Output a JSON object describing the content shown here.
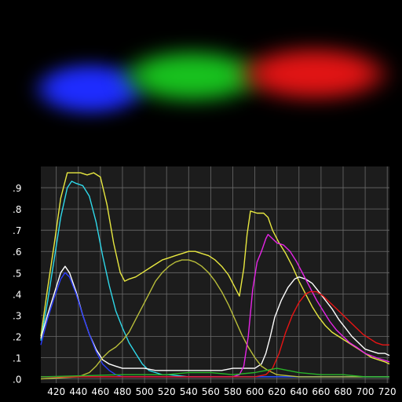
{
  "spectrum_strip": {
    "bands": [
      {
        "name": "blue-band",
        "color": "#1e2cff"
      },
      {
        "name": "green-band",
        "color": "#18c21e"
      },
      {
        "name": "red-band",
        "color": "#e11414"
      }
    ]
  },
  "chart_data": {
    "type": "line",
    "title": "",
    "xlabel": "",
    "ylabel": "",
    "xlim": [
      406,
      722
    ],
    "ylim": [
      -0.02,
      1.0
    ],
    "grid": true,
    "background": "#1c1c1c",
    "gridColor": "#6a6a6a",
    "x_ticks": [
      {
        "value": 420,
        "label": "420"
      },
      {
        "value": 440,
        "label": "440"
      },
      {
        "value": 460,
        "label": "460"
      },
      {
        "value": 480,
        "label": "480"
      },
      {
        "value": 500,
        "label": "500"
      },
      {
        "value": 520,
        "label": "520"
      },
      {
        "value": 540,
        "label": "540"
      },
      {
        "value": 560,
        "label": "560"
      },
      {
        "value": 580,
        "label": "580"
      },
      {
        "value": 600,
        "label": "600"
      },
      {
        "value": 620,
        "label": "620"
      },
      {
        "value": 640,
        "label": "640"
      },
      {
        "value": 660,
        "label": "660"
      },
      {
        "value": 680,
        "label": "680"
      },
      {
        "value": 700,
        "label": "700"
      },
      {
        "value": 720,
        "label": "720"
      }
    ],
    "y_ticks": [
      {
        "value": 0.0,
        "label": ".0"
      },
      {
        "value": 0.1,
        "label": ".1"
      },
      {
        "value": 0.2,
        "label": ".2"
      },
      {
        "value": 0.3,
        "label": ".3"
      },
      {
        "value": 0.4,
        "label": ".4"
      },
      {
        "value": 0.5,
        "label": ".5"
      },
      {
        "value": 0.6,
        "label": ".6"
      },
      {
        "value": 0.7,
        "label": ".7"
      },
      {
        "value": 0.8,
        "label": ".8"
      },
      {
        "value": 0.9,
        "label": ".9"
      }
    ],
    "series": [
      {
        "id": "yellow",
        "color": "#e8e840",
        "points": [
          [
            406,
            0.2
          ],
          [
            412,
            0.42
          ],
          [
            418,
            0.63
          ],
          [
            424,
            0.85
          ],
          [
            430,
            0.97
          ],
          [
            436,
            0.97
          ],
          [
            442,
            0.97
          ],
          [
            448,
            0.96
          ],
          [
            454,
            0.97
          ],
          [
            460,
            0.95
          ],
          [
            466,
            0.82
          ],
          [
            472,
            0.64
          ],
          [
            478,
            0.5
          ],
          [
            482,
            0.46
          ],
          [
            486,
            0.47
          ],
          [
            492,
            0.48
          ],
          [
            498,
            0.5
          ],
          [
            504,
            0.52
          ],
          [
            510,
            0.54
          ],
          [
            516,
            0.56
          ],
          [
            522,
            0.57
          ],
          [
            528,
            0.58
          ],
          [
            534,
            0.59
          ],
          [
            540,
            0.6
          ],
          [
            546,
            0.6
          ],
          [
            552,
            0.59
          ],
          [
            558,
            0.58
          ],
          [
            564,
            0.56
          ],
          [
            570,
            0.53
          ],
          [
            576,
            0.49
          ],
          [
            582,
            0.43
          ],
          [
            586,
            0.39
          ],
          [
            590,
            0.52
          ],
          [
            593,
            0.68
          ],
          [
            596,
            0.79
          ],
          [
            602,
            0.78
          ],
          [
            608,
            0.78
          ],
          [
            612,
            0.76
          ],
          [
            616,
            0.7
          ],
          [
            622,
            0.64
          ],
          [
            628,
            0.59
          ],
          [
            634,
            0.53
          ],
          [
            640,
            0.46
          ],
          [
            646,
            0.4
          ],
          [
            652,
            0.34
          ],
          [
            658,
            0.29
          ],
          [
            664,
            0.25
          ],
          [
            670,
            0.22
          ],
          [
            676,
            0.2
          ],
          [
            682,
            0.18
          ],
          [
            688,
            0.16
          ],
          [
            694,
            0.14
          ],
          [
            700,
            0.12
          ],
          [
            706,
            0.1
          ],
          [
            712,
            0.09
          ],
          [
            718,
            0.08
          ],
          [
            722,
            0.07
          ]
        ]
      },
      {
        "id": "cyan",
        "color": "#2fd9ea",
        "points": [
          [
            406,
            0.18
          ],
          [
            412,
            0.36
          ],
          [
            418,
            0.56
          ],
          [
            424,
            0.76
          ],
          [
            430,
            0.9
          ],
          [
            434,
            0.93
          ],
          [
            438,
            0.92
          ],
          [
            444,
            0.91
          ],
          [
            450,
            0.86
          ],
          [
            456,
            0.74
          ],
          [
            462,
            0.58
          ],
          [
            468,
            0.44
          ],
          [
            474,
            0.32
          ],
          [
            480,
            0.24
          ],
          [
            486,
            0.17
          ],
          [
            492,
            0.12
          ],
          [
            498,
            0.07
          ],
          [
            504,
            0.04
          ],
          [
            510,
            0.03
          ],
          [
            516,
            0.02
          ],
          [
            522,
            0.02
          ],
          [
            540,
            0.01
          ],
          [
            600,
            0.01
          ],
          [
            660,
            0.01
          ],
          [
            722,
            0.01
          ]
        ]
      },
      {
        "id": "white-left",
        "color": "#ffffff",
        "points": [
          [
            406,
            0.19
          ],
          [
            412,
            0.3
          ],
          [
            418,
            0.4
          ],
          [
            424,
            0.5
          ],
          [
            428,
            0.53
          ],
          [
            432,
            0.5
          ],
          [
            438,
            0.41
          ],
          [
            444,
            0.3
          ],
          [
            450,
            0.21
          ],
          [
            456,
            0.14
          ],
          [
            462,
            0.09
          ],
          [
            468,
            0.07
          ],
          [
            474,
            0.06
          ],
          [
            480,
            0.05
          ],
          [
            490,
            0.05
          ],
          [
            500,
            0.05
          ],
          [
            510,
            0.04
          ],
          [
            520,
            0.04
          ],
          [
            530,
            0.04
          ],
          [
            540,
            0.04
          ],
          [
            550,
            0.04
          ],
          [
            560,
            0.04
          ],
          [
            570,
            0.04
          ],
          [
            580,
            0.05
          ],
          [
            590,
            0.05
          ],
          [
            600,
            0.05
          ],
          [
            606,
            0.07
          ],
          [
            610,
            0.12
          ],
          [
            614,
            0.2
          ],
          [
            618,
            0.29
          ],
          [
            624,
            0.37
          ],
          [
            630,
            0.43
          ],
          [
            636,
            0.47
          ],
          [
            640,
            0.48
          ],
          [
            646,
            0.47
          ],
          [
            652,
            0.45
          ],
          [
            658,
            0.41
          ],
          [
            664,
            0.37
          ],
          [
            670,
            0.33
          ],
          [
            676,
            0.28
          ],
          [
            682,
            0.24
          ],
          [
            688,
            0.2
          ],
          [
            694,
            0.17
          ],
          [
            700,
            0.14
          ],
          [
            706,
            0.13
          ],
          [
            712,
            0.12
          ],
          [
            718,
            0.12
          ],
          [
            722,
            0.11
          ]
        ]
      },
      {
        "id": "blue",
        "color": "#2b3cff",
        "points": [
          [
            406,
            0.16
          ],
          [
            412,
            0.28
          ],
          [
            418,
            0.38
          ],
          [
            424,
            0.47
          ],
          [
            428,
            0.5
          ],
          [
            432,
            0.48
          ],
          [
            438,
            0.4
          ],
          [
            444,
            0.3
          ],
          [
            450,
            0.21
          ],
          [
            456,
            0.13
          ],
          [
            462,
            0.07
          ],
          [
            468,
            0.04
          ],
          [
            474,
            0.02
          ],
          [
            480,
            0.01
          ],
          [
            500,
            0.01
          ],
          [
            600,
            0.01
          ],
          [
            722,
            0.01
          ]
        ]
      },
      {
        "id": "olive",
        "color": "#b8bd3a",
        "points": [
          [
            406,
            0.0
          ],
          [
            440,
            0.01
          ],
          [
            450,
            0.03
          ],
          [
            456,
            0.06
          ],
          [
            462,
            0.1
          ],
          [
            468,
            0.13
          ],
          [
            474,
            0.15
          ],
          [
            480,
            0.18
          ],
          [
            486,
            0.22
          ],
          [
            492,
            0.28
          ],
          [
            498,
            0.34
          ],
          [
            504,
            0.4
          ],
          [
            510,
            0.46
          ],
          [
            516,
            0.5
          ],
          [
            522,
            0.53
          ],
          [
            528,
            0.55
          ],
          [
            534,
            0.56
          ],
          [
            540,
            0.56
          ],
          [
            546,
            0.55
          ],
          [
            552,
            0.53
          ],
          [
            558,
            0.5
          ],
          [
            564,
            0.46
          ],
          [
            570,
            0.41
          ],
          [
            576,
            0.35
          ],
          [
            582,
            0.28
          ],
          [
            588,
            0.21
          ],
          [
            594,
            0.15
          ],
          [
            600,
            0.1
          ],
          [
            606,
            0.06
          ],
          [
            612,
            0.04
          ],
          [
            620,
            0.02
          ],
          [
            640,
            0.01
          ],
          [
            722,
            0.01
          ]
        ]
      },
      {
        "id": "magenta",
        "color": "#e625e6",
        "points": [
          [
            406,
            0.01
          ],
          [
            580,
            0.01
          ],
          [
            586,
            0.02
          ],
          [
            590,
            0.06
          ],
          [
            594,
            0.2
          ],
          [
            598,
            0.42
          ],
          [
            602,
            0.55
          ],
          [
            606,
            0.6
          ],
          [
            610,
            0.66
          ],
          [
            612,
            0.68
          ],
          [
            616,
            0.66
          ],
          [
            620,
            0.64
          ],
          [
            626,
            0.63
          ],
          [
            632,
            0.6
          ],
          [
            638,
            0.55
          ],
          [
            644,
            0.49
          ],
          [
            650,
            0.43
          ],
          [
            656,
            0.37
          ],
          [
            662,
            0.32
          ],
          [
            668,
            0.27
          ],
          [
            674,
            0.23
          ],
          [
            680,
            0.2
          ],
          [
            686,
            0.17
          ],
          [
            692,
            0.15
          ],
          [
            700,
            0.12
          ],
          [
            710,
            0.1
          ],
          [
            722,
            0.08
          ]
        ]
      },
      {
        "id": "red",
        "color": "#e81414",
        "points": [
          [
            406,
            0.01
          ],
          [
            600,
            0.01
          ],
          [
            610,
            0.02
          ],
          [
            616,
            0.05
          ],
          [
            622,
            0.12
          ],
          [
            628,
            0.22
          ],
          [
            634,
            0.3
          ],
          [
            640,
            0.36
          ],
          [
            646,
            0.4
          ],
          [
            650,
            0.41
          ],
          [
            656,
            0.41
          ],
          [
            662,
            0.39
          ],
          [
            668,
            0.36
          ],
          [
            674,
            0.33
          ],
          [
            680,
            0.3
          ],
          [
            686,
            0.27
          ],
          [
            692,
            0.24
          ],
          [
            698,
            0.21
          ],
          [
            704,
            0.19
          ],
          [
            710,
            0.17
          ],
          [
            716,
            0.16
          ],
          [
            722,
            0.16
          ]
        ]
      },
      {
        "id": "green",
        "color": "#28b428",
        "points": [
          [
            406,
            0.01
          ],
          [
            480,
            0.02
          ],
          [
            500,
            0.02
          ],
          [
            520,
            0.02
          ],
          [
            540,
            0.03
          ],
          [
            560,
            0.03
          ],
          [
            580,
            0.02
          ],
          [
            600,
            0.03
          ],
          [
            610,
            0.04
          ],
          [
            620,
            0.05
          ],
          [
            630,
            0.04
          ],
          [
            640,
            0.03
          ],
          [
            660,
            0.02
          ],
          [
            680,
            0.02
          ],
          [
            700,
            0.01
          ],
          [
            722,
            0.01
          ]
        ]
      }
    ]
  }
}
